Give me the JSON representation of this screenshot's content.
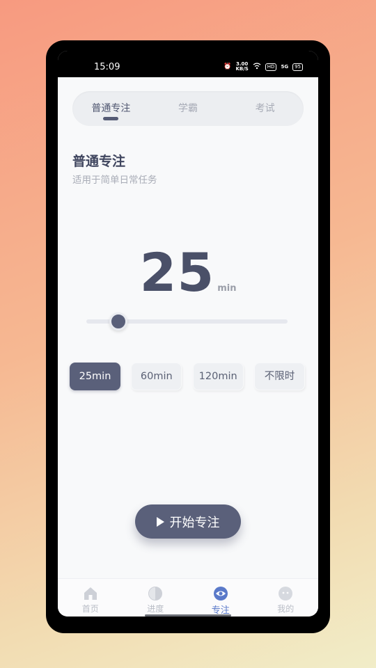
{
  "status_bar": {
    "time": "15:09",
    "net_speed_value": "3.00",
    "net_speed_unit": "KB/S",
    "hd_badge": "HD",
    "signal_label": "5G",
    "battery": "95"
  },
  "tabs": [
    {
      "label": "普通专注",
      "active": true
    },
    {
      "label": "学霸",
      "active": false
    },
    {
      "label": "考试",
      "active": false
    }
  ],
  "mode": {
    "title": "普通专注",
    "subtitle": "适用于简单日常任务"
  },
  "timer": {
    "value": "25",
    "unit": "min"
  },
  "slider": {
    "level_fraction": 0.16
  },
  "presets": [
    {
      "label": "25min",
      "active": true
    },
    {
      "label": "60min",
      "active": false
    },
    {
      "label": "120min",
      "active": false
    },
    {
      "label": "不限时",
      "active": false
    }
  ],
  "start_button": {
    "label": "开始专注"
  },
  "bottom_nav": [
    {
      "label": "首页",
      "icon": "home-icon",
      "active": false
    },
    {
      "label": "进度",
      "icon": "progress-icon",
      "active": false
    },
    {
      "label": "专注",
      "icon": "eye-icon",
      "active": true
    },
    {
      "label": "我的",
      "icon": "profile-icon",
      "active": false
    }
  ],
  "colors": {
    "accent": "#5a607a",
    "nav_active": "#5a79c9",
    "nav_inactive": "#b9bdc6"
  }
}
